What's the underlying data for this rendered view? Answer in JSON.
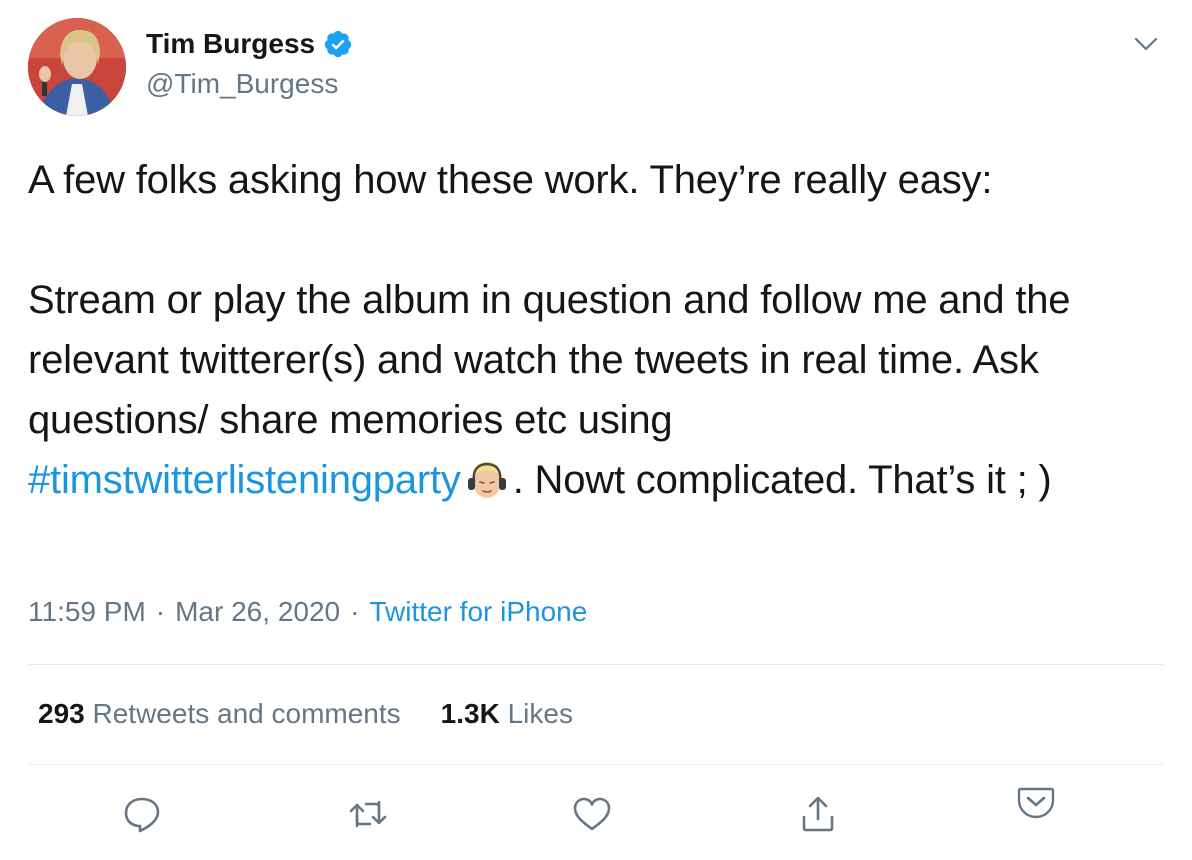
{
  "author": {
    "display_name": "Tim Burgess",
    "handle": "@Tim_Burgess",
    "verified": true,
    "avatar_icon": "avatar-photo"
  },
  "tweet": {
    "line1": "A few folks asking how these work. They’re really easy:",
    "line2_lead": "Stream or play the album in question and follow me and the relevant twitterer(s) and watch the tweets in real time. Ask questions/ share memories etc using",
    "hashtag": "#timstwitterlisteningparty",
    "hashtag_emoji": "blond-head-with-headphones",
    "line2_tail": ". Nowt complicated. That’s it ; )"
  },
  "meta": {
    "time": "11:59 PM",
    "separator": "·",
    "date": "Mar 26, 2020",
    "source": "Twitter for iPhone"
  },
  "stats": {
    "retweets_count": "293",
    "retweets_label": "Retweets and comments",
    "likes_count": "1.3K",
    "likes_label": "Likes"
  },
  "actions": [
    "comment-icon",
    "retweet-icon",
    "like-icon",
    "share-icon",
    "pocket-icon"
  ],
  "colors": {
    "link": "#1b95e0",
    "text": "#14171a",
    "muted": "#657786",
    "divider": "#e6ecf0",
    "verified": "#1da1f2"
  }
}
